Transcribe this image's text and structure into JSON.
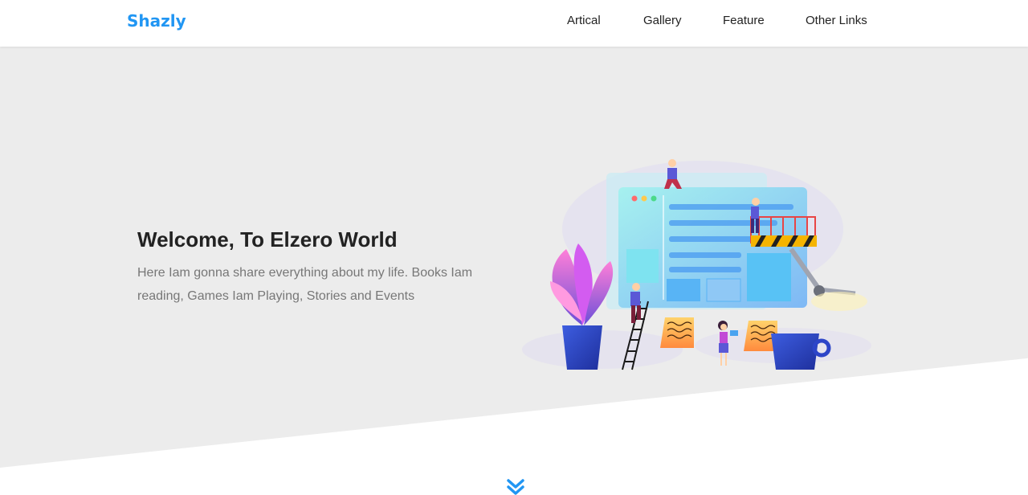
{
  "header": {
    "logo": "Shazly",
    "nav": [
      {
        "label": "Artical"
      },
      {
        "label": "Gallery"
      },
      {
        "label": "Feature"
      },
      {
        "label": "Other Links"
      }
    ]
  },
  "hero": {
    "title": "Welcome, To Elzero World",
    "description": "Here Iam gonna share everything about my life. Books Iam reading, Games Iam Playing, Stories and Events"
  },
  "colors": {
    "brand": "#2196f3",
    "hero_bg": "#ececec",
    "text_dark": "#222222",
    "text_muted": "#777777"
  },
  "icons": {
    "scroll": "double-chevron-down-icon"
  }
}
